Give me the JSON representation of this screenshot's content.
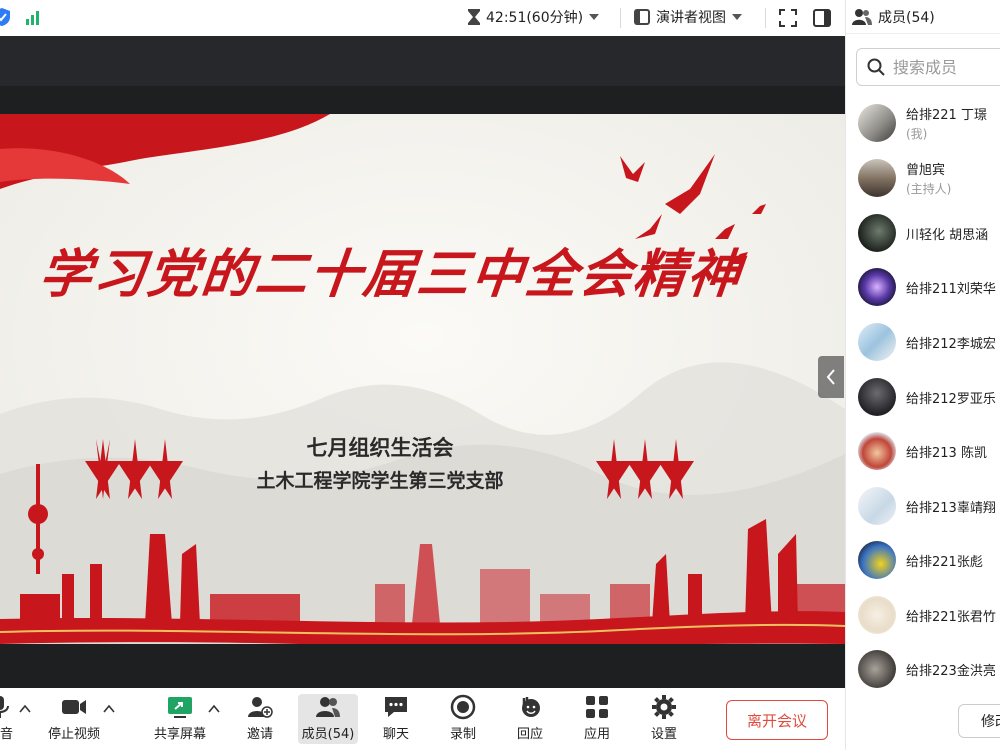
{
  "topbar": {
    "timer": "42:51(60分钟)",
    "view_mode": "演讲者视图"
  },
  "slide": {
    "title": "学习党的二十届三中全会精神",
    "subtitle_line1": "七月组织生活会",
    "subtitle_line2": "土木工程学院学生第三党支部"
  },
  "toolbar": {
    "audio_label": "静音",
    "video_label": "停止视频",
    "share_label": "共享屏幕",
    "invite_label": "邀请",
    "members_label": "成员(54)",
    "chat_label": "聊天",
    "record_label": "录制",
    "reaction_label": "回应",
    "apps_label": "应用",
    "settings_label": "设置",
    "leave_label": "离开会议"
  },
  "panel": {
    "title": "成员(54)",
    "search_placeholder": "搜索成员",
    "modify_label": "修改",
    "members": [
      {
        "name": "给排221 丁璟",
        "role": "(我)"
      },
      {
        "name": "曾旭宾",
        "role": "(主持人)"
      },
      {
        "name": "川轻化 胡思涵",
        "role": ""
      },
      {
        "name": "给排211刘荣华",
        "role": ""
      },
      {
        "name": "给排212李城宏",
        "role": ""
      },
      {
        "name": "给排212罗亚乐",
        "role": ""
      },
      {
        "name": "给排213 陈凯",
        "role": ""
      },
      {
        "name": "给排213辜靖翔",
        "role": ""
      },
      {
        "name": "给排221张彪",
        "role": ""
      },
      {
        "name": "给排221张君竹",
        "role": ""
      },
      {
        "name": "给排223金洪亮",
        "role": ""
      }
    ]
  },
  "colors": {
    "accent_red": "#c8161d",
    "leave_red": "#e04b3f",
    "signal_green": "#1fb36b",
    "shield_blue": "#2d7cf6"
  }
}
